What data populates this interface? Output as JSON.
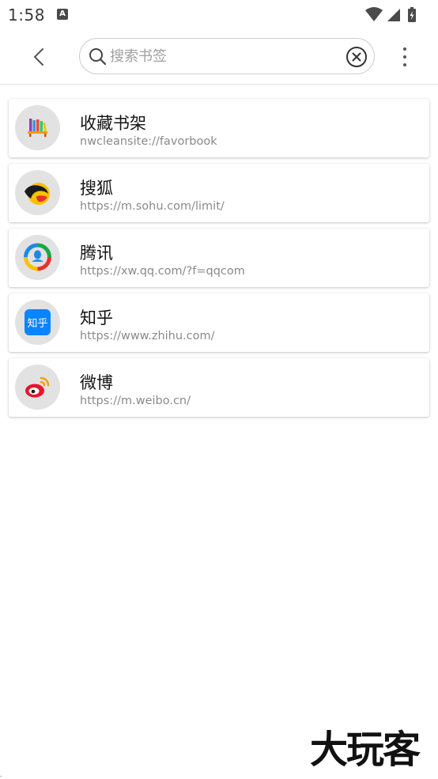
{
  "status_bar": {
    "time": "1:58",
    "notification_icon": "A"
  },
  "toolbar": {
    "search_placeholder": "搜索书签",
    "search_value": ""
  },
  "bookmarks": [
    {
      "title": "收藏书架",
      "url": "nwcleansite://favorbook",
      "icon": "bookshelf-icon"
    },
    {
      "title": "搜狐",
      "url": "https://m.sohu.com/limit/",
      "icon": "sohu-icon"
    },
    {
      "title": "腾讯",
      "url": "https://xw.qq.com/?f=qqcom",
      "icon": "tencent-icon"
    },
    {
      "title": "知乎",
      "url": "https://www.zhihu.com/",
      "icon": "zhihu-icon",
      "icon_text": "知乎"
    },
    {
      "title": "微博",
      "url": "https://m.weibo.cn/",
      "icon": "weibo-icon"
    }
  ],
  "watermark": {
    "text": "大玩客"
  },
  "colors": {
    "zhihu_blue": "#0a84ff",
    "sohu_yellow": "#f6c200",
    "weibo_red": "#e6162d",
    "tencent_green": "#19a84a"
  }
}
